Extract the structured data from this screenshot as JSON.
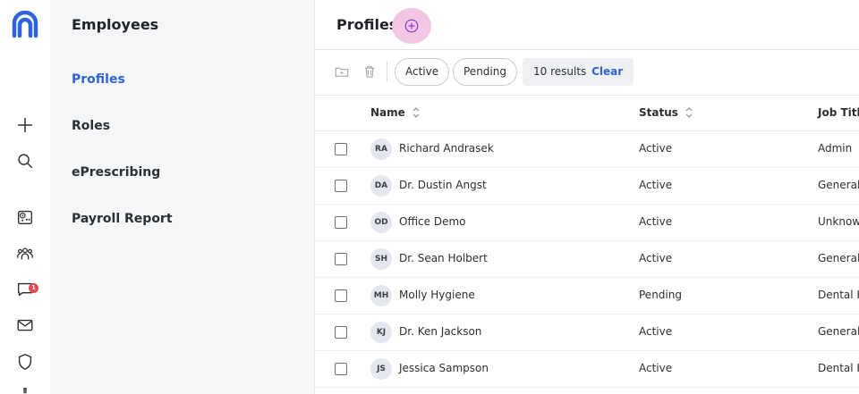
{
  "rail": {
    "logo": "brand-logo",
    "brand_color": "#2f63d9",
    "icons": [
      "plus-icon",
      "search-icon",
      "calendar-clock-icon",
      "people-icon",
      "chat-icon",
      "mail-icon",
      "shield-icon"
    ],
    "chat_badge": "1",
    "badge_color": "#e5484d"
  },
  "subnav": {
    "title": "Employees",
    "items": [
      {
        "label": "Profiles",
        "active": true
      },
      {
        "label": "Roles",
        "active": false
      },
      {
        "label": "ePrescribing",
        "active": false
      },
      {
        "label": "Payroll Report",
        "active": false
      }
    ],
    "active_color": "#2f63d9"
  },
  "header": {
    "title": "Profiles",
    "add_icon": "plus-circle-icon"
  },
  "toolbar": {
    "folder_icon": "folder-icon",
    "trash_icon": "trash-icon",
    "chips": [
      "Active",
      "Pending"
    ],
    "results_text": "10 results",
    "clear_label": "Clear"
  },
  "table": {
    "columns": [
      "Name",
      "Status",
      "Job Title"
    ],
    "rows": [
      {
        "initials": "RA",
        "name": "Richard Andrasek",
        "status": "Active",
        "job": "Admin"
      },
      {
        "initials": "DA",
        "name": "Dr. Dustin Angst",
        "status": "Active",
        "job": "General"
      },
      {
        "initials": "OD",
        "name": "Office Demo",
        "status": "Active",
        "job": "Unknow"
      },
      {
        "initials": "SH",
        "name": "Dr. Sean Holbert",
        "status": "Active",
        "job": "General"
      },
      {
        "initials": "MH",
        "name": "Molly Hygiene",
        "status": "Pending",
        "job": "Dental H"
      },
      {
        "initials": "KJ",
        "name": "Dr. Ken Jackson",
        "status": "Active",
        "job": "General"
      },
      {
        "initials": "JS",
        "name": "Jessica Sampson",
        "status": "Active",
        "job": "Dental H"
      }
    ]
  }
}
